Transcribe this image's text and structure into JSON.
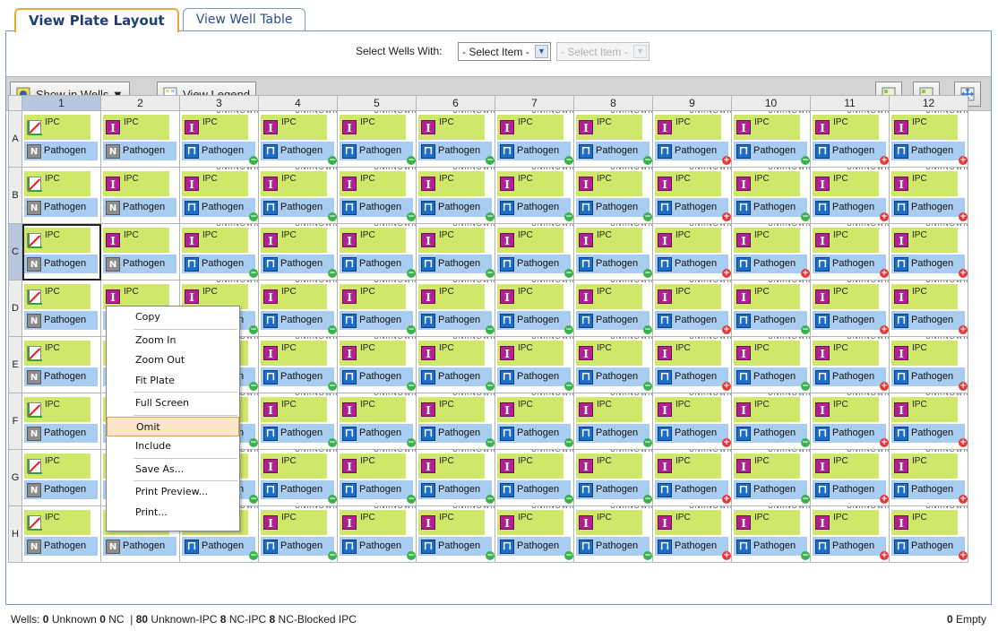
{
  "tabs": [
    "View Plate Layout",
    "View Well Table"
  ],
  "select": {
    "label": "Select Wells With:",
    "primary": "- Select Item -",
    "secondary": "- Select Item -"
  },
  "toolbar": {
    "show_in_wells": "Show in Wells ▼",
    "view_legend": "View Legend",
    "icons": [
      "zoom-in-icon",
      "zoom-out-icon",
      "fit-plate-icon"
    ]
  },
  "columns": [
    "1",
    "2",
    "3",
    "4",
    "5",
    "6",
    "7",
    "8",
    "9",
    "10",
    "11",
    "12"
  ],
  "rows": [
    "A",
    "B",
    "C",
    "D",
    "E",
    "F",
    "G",
    "H"
  ],
  "well": {
    "target1": "IPC",
    "target2": "Pathogen",
    "sample_prefix": "UNKNOWN"
  },
  "plus_columns": {
    "A": [
      9,
      11,
      12
    ],
    "B": [
      9,
      11,
      12
    ],
    "C": [
      9,
      10,
      11,
      12
    ],
    "D": [
      9,
      11,
      12
    ],
    "E": [
      9,
      11,
      12
    ],
    "F": [
      9,
      11,
      12
    ],
    "G": [
      9,
      11,
      12
    ],
    "H": [
      9,
      11,
      12
    ]
  },
  "context_menu": [
    "Copy",
    "Zoom In",
    "Zoom Out",
    "Fit Plate",
    "Full Screen",
    "Omit",
    "Include",
    "Save As...",
    "Print Preview...",
    "Print..."
  ],
  "context_menu_highlight": "Omit",
  "footer": {
    "wells_label": "Wells:",
    "unknown_count": "0",
    "unknown_label": "Unknown",
    "nc_count": "0",
    "nc_label": "NC",
    "sep": "|",
    "unknown_ipc_count": "80",
    "unknown_ipc_label": "Unknown-IPC",
    "nc_ipc_count": "8",
    "nc_ipc_label": "NC-IPC",
    "nc_blocked_count": "8",
    "nc_blocked_label": "NC-Blocked IPC",
    "empty_count": "0",
    "empty_label": "Empty"
  },
  "colors": {
    "ipc_bg": "#cfe86a",
    "pathogen_bg": "#a9cdf0",
    "tab_active_border": "#e6a92d",
    "menu_highlight": "#fbe6c8"
  }
}
